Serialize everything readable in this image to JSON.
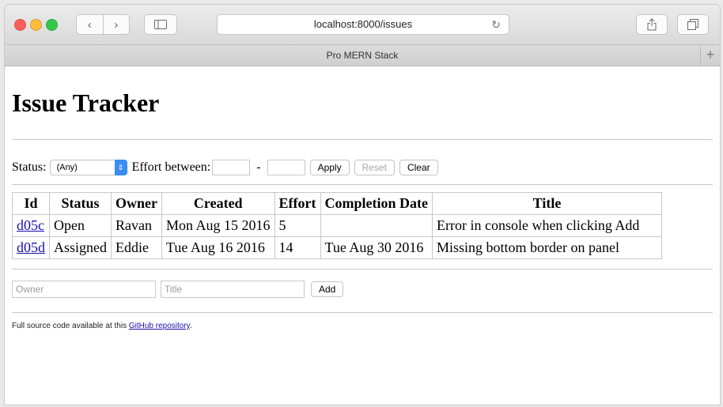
{
  "browser": {
    "url": "localhost:8000/issues",
    "tab_title": "Pro MERN Stack",
    "back_glyph": "‹",
    "forward_glyph": "›",
    "reload_glyph": "↻",
    "new_tab_glyph": "+",
    "icons": [
      "close-icon",
      "minimize-icon",
      "maximize-icon",
      "chevron-left-icon",
      "chevron-right-icon",
      "sidebar-icon",
      "reload-icon",
      "share-icon",
      "tabs-icon",
      "plus-icon"
    ]
  },
  "page": {
    "title": "Issue Tracker"
  },
  "filter": {
    "status_label": "Status:",
    "status_value": "(Any)",
    "effort_label": "Effort between:",
    "dash": "-",
    "apply": "Apply",
    "reset": "Reset",
    "clear": "Clear"
  },
  "table": {
    "headers": [
      "Id",
      "Status",
      "Owner",
      "Created",
      "Effort",
      "Completion Date",
      "Title"
    ],
    "rows": [
      {
        "id": "d05c",
        "status": "Open",
        "owner": "Ravan",
        "created": "Mon Aug 15 2016",
        "effort": "5",
        "completion": "",
        "title": "Error in console when clicking Add"
      },
      {
        "id": "d05d",
        "status": "Assigned",
        "owner": "Eddie",
        "created": "Tue Aug 16 2016",
        "effort": "14",
        "completion": "Tue Aug 30 2016",
        "title": "Missing bottom border on panel"
      }
    ]
  },
  "add_form": {
    "owner_placeholder": "Owner",
    "title_placeholder": "Title",
    "add": "Add"
  },
  "footer": {
    "text": "Full source code available at this ",
    "link": "GitHub repository",
    "suffix": "."
  },
  "colors": {
    "link": "#1a0dab",
    "select_accent": "#3b8cf5"
  }
}
